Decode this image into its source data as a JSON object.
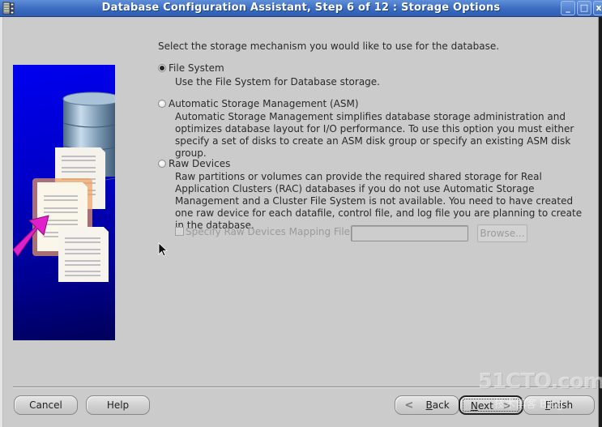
{
  "window": {
    "title": "Database Configuration Assistant, Step 6 of 12 : Storage Options",
    "controls": {
      "minimize": "_",
      "maximize": "□",
      "close": "x"
    }
  },
  "content": {
    "intro": "Select the storage mechanism you would like to use for the database.",
    "options": [
      {
        "label": "File System",
        "selected": true,
        "description": "Use the File System for Database storage."
      },
      {
        "label": "Automatic Storage Management (ASM)",
        "selected": false,
        "description": "Automatic Storage Management simplifies database storage administration and optimizes database layout for I/O performance. To use this option you must either specify a set of disks to create an ASM disk group or specify an existing ASM disk group."
      },
      {
        "label": "Raw Devices",
        "selected": false,
        "description": "Raw partitions or volumes can provide the required shared storage for Real Application Clusters (RAC) databases if you do not use Automatic Storage Management and a Cluster File System is not available.  You need to have created one raw device for each datafile, control file, and log file you are planning to create in the database."
      }
    ],
    "raw_mapping": {
      "checkbox_label": "Specify Raw Devices Mapping File",
      "checked": false,
      "enabled": false,
      "file_value": "",
      "browse_label": "Browse..."
    }
  },
  "buttons": {
    "cancel": "Cancel",
    "help": "Help",
    "back_arrow": "<",
    "back_mnemonic": "B",
    "back_rest": "ack",
    "next_mnemonic": "N",
    "next_rest": "ext",
    "next_arrow": ">",
    "finish_mnemonic": "F",
    "finish_rest": "inish"
  },
  "watermark": {
    "main": "51CTO.com",
    "sub": "技术博客  Blog"
  },
  "colors": {
    "titlebar": "#3a6bc0",
    "dialog_bg": "#cbcbcb",
    "illustration_bg": "#0000c8",
    "arrow_magenta": "#e020c8"
  }
}
